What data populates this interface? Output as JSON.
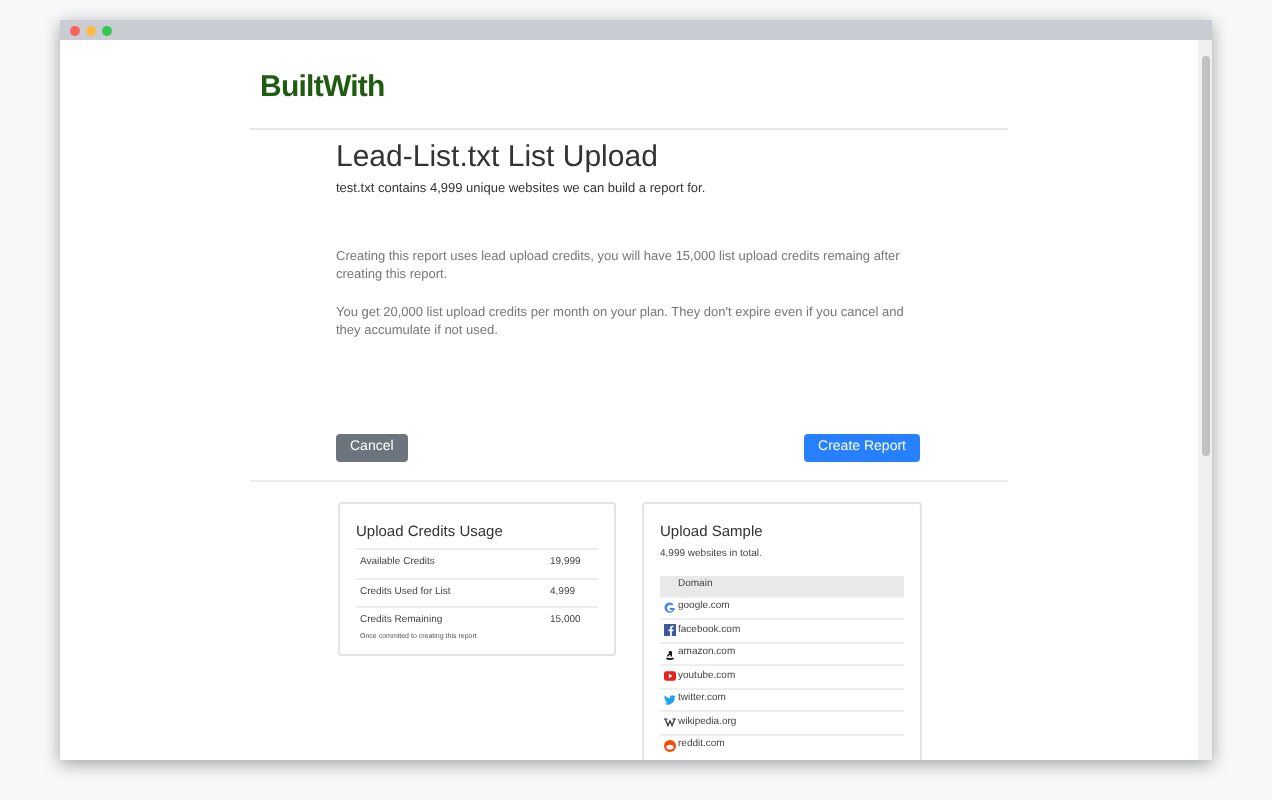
{
  "logo": "BuiltWith",
  "title": "Lead-List.txt List Upload",
  "subtitle": "test.txt contains 4,999 unique websites we can build a report for.",
  "paragraphs": [
    "Creating this report uses lead upload credits, you will have 15,000 list upload credits remaing after creating this report.",
    "You get 20,000 list upload credits per month on your plan. They don't expire even if you cancel and they accumulate if not used."
  ],
  "buttons": {
    "cancel": "Cancel",
    "create": "Create Report"
  },
  "credits": {
    "title": "Upload Credits Usage",
    "rows": [
      {
        "label": "Available Credits",
        "value": "19,999"
      },
      {
        "label": "Credits Used for List",
        "value": "4,999"
      },
      {
        "label": "Credits Remaining",
        "value": "15,000",
        "note": "Once commited to creating this report"
      }
    ]
  },
  "sample": {
    "title": "Upload Sample",
    "summary": "4,999 websites in total.",
    "column": "Domain",
    "rows": [
      {
        "domain": "google.com",
        "kind": "google"
      },
      {
        "domain": "facebook.com",
        "kind": "facebook"
      },
      {
        "domain": "amazon.com",
        "kind": "amazon"
      },
      {
        "domain": "youtube.com",
        "kind": "youtube"
      },
      {
        "domain": "twitter.com",
        "kind": "twitter"
      },
      {
        "domain": "wikipedia.org",
        "kind": "wikipedia"
      },
      {
        "domain": "reddit.com",
        "kind": "reddit"
      }
    ]
  }
}
